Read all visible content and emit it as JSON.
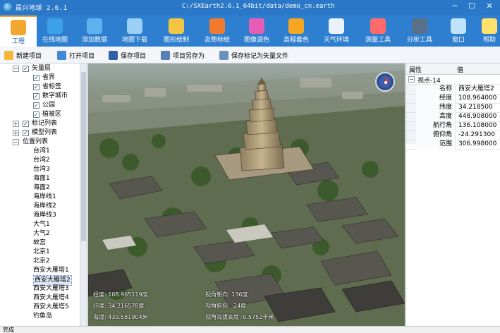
{
  "window": {
    "app_name": "晨兴地球 2.6.1",
    "path": "C:/SXEarth2.6.1_64bit/data/demo_cn.earth",
    "min": "─",
    "max": "☐",
    "close": "✕"
  },
  "ribbon": {
    "tabs": [
      {
        "label": "工程",
        "icon": "folder-icon",
        "color": "#f2a82f"
      },
      {
        "label": "在线地图",
        "icon": "globe-icon",
        "color": "#3ea0e6"
      },
      {
        "label": "添加数据",
        "icon": "monitor-icon",
        "color": "#5cb3f0"
      },
      {
        "label": "地图下载",
        "icon": "download-map-icon",
        "color": "#9ad0f5"
      },
      {
        "label": "图形绘制",
        "icon": "draw-tools-icon",
        "color": "#f3c542"
      },
      {
        "label": "态势标绘",
        "icon": "pin-icon",
        "color": "#f07b2f"
      },
      {
        "label": "图像调色",
        "icon": "color-wheel-icon",
        "color": "#e65db8"
      },
      {
        "label": "高程着色",
        "icon": "terrain-icon",
        "color": "#f5a623"
      },
      {
        "label": "天气环境",
        "icon": "weather-icon",
        "color": "#e9f2fb"
      },
      {
        "label": "测量工具",
        "icon": "measure-icon",
        "color": "#ff6a6a"
      },
      {
        "label": "分析工具",
        "icon": "analysis-icon",
        "color": "#5a6f8a"
      },
      {
        "label": "窗口",
        "icon": "window-icon",
        "color": "#bfe3fb"
      },
      {
        "label": "帮助",
        "icon": "help-bulb-icon",
        "color": "#ffe16b"
      }
    ]
  },
  "toolbar": {
    "new_project": "新建项目",
    "open_project": "打开项目",
    "save_project": "保存项目",
    "save_as": "项目另存为",
    "save_markers_vector": "保存标记为矢量文件"
  },
  "tree": {
    "vector_layer": "矢量层",
    "vector_children": [
      "省界",
      "省标签",
      "数字城市",
      "公园",
      "植被区"
    ],
    "marker_list": "标记列表",
    "model_list": "模型列表",
    "position_list": "位置列表",
    "positions": [
      "台湾1",
      "台湾2",
      "台湾3",
      "海面1",
      "海面2",
      "海岸线1",
      "海岸线2",
      "海岸线3",
      "大气1",
      "大气2",
      "故宫",
      "北京1",
      "北京2",
      "西安大雁塔1",
      "西安大雁塔2",
      "西安大雁塔3",
      "西安大雁塔4",
      "西安大雁塔5",
      "钓鱼岛"
    ],
    "selected": "西安大雁塔2"
  },
  "viewport": {
    "lon": "经度: 108.965119度",
    "lat": "纬度: 34.216578度",
    "alt": "海拔: 439.581904米",
    "heading": "视角朝向: 136度",
    "pitch": "视角俯仰: -24度",
    "eye_alt": "视角海拔高度: 0.5752千米"
  },
  "props": {
    "col_name": "属性",
    "col_value": "值",
    "group": "视点-14",
    "rows": [
      {
        "k": "名称",
        "v": "西安大雁塔2"
      },
      {
        "k": "经度",
        "v": "108.964000"
      },
      {
        "k": "纬度",
        "v": "34.218500"
      },
      {
        "k": "高度",
        "v": "448.908000"
      },
      {
        "k": "航行角",
        "v": "136.108000"
      },
      {
        "k": "俯仰角",
        "v": "-24.291300"
      },
      {
        "k": "范围",
        "v": "306.998000"
      }
    ]
  },
  "status": {
    "text": "完成"
  },
  "watermark": {
    "text": "下载吧"
  }
}
